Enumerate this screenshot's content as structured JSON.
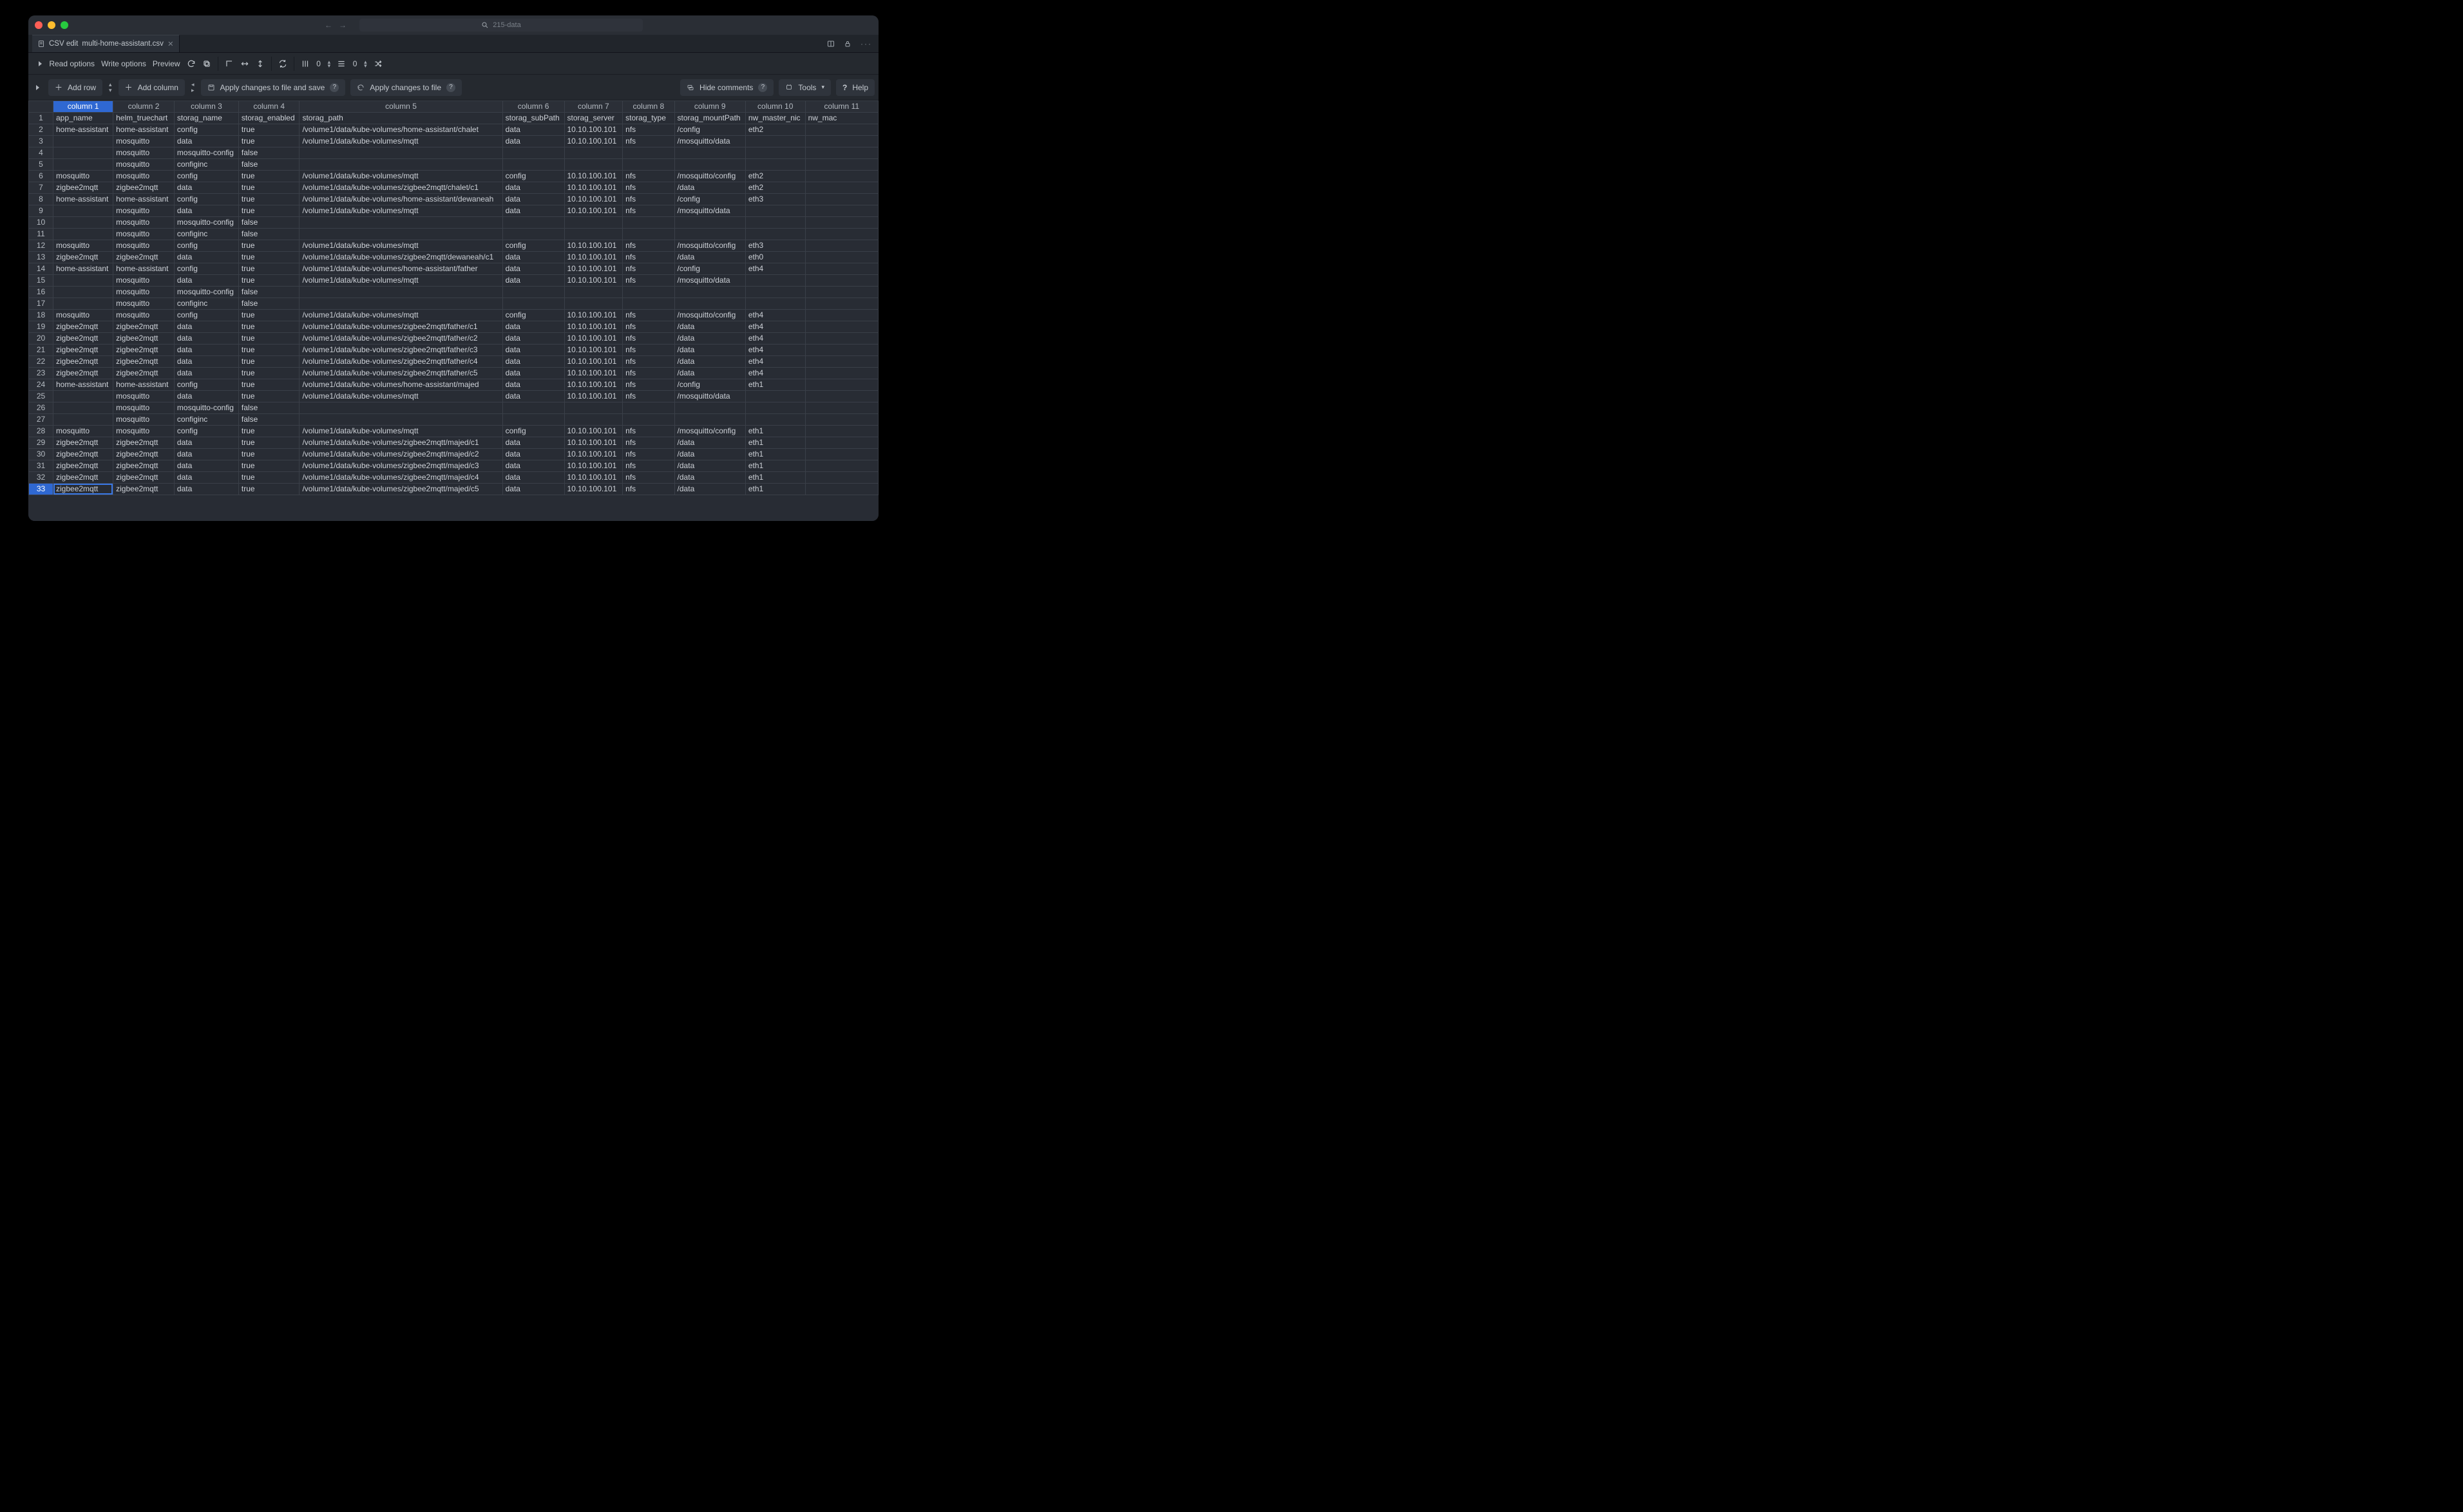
{
  "titlebar": {
    "search_text": "215-data"
  },
  "tab": {
    "prefix": "CSV edit",
    "filename": "multi-home-assistant.csv"
  },
  "toolbar": {
    "read_options": "Read options",
    "write_options": "Write options",
    "preview": "Preview",
    "colwidth_val": "0",
    "rowheight_val": "0"
  },
  "actionbar": {
    "add_row": "Add row",
    "add_column": "Add column",
    "apply_save": "Apply changes to file and save",
    "apply": "Apply changes to file",
    "hide_comments": "Hide comments",
    "tools": "Tools",
    "help": "Help"
  },
  "columns": [
    "",
    "column 1",
    "column 2",
    "column 3",
    "column 4",
    "column 5",
    "column 6",
    "column 7",
    "column 8",
    "column 9",
    "column 10",
    "column 11"
  ],
  "selected_col": 1,
  "selected_row": 33,
  "rows": [
    [
      "app_name",
      "helm_truechart",
      "storag_name",
      "storag_enabled",
      "storag_path",
      "storag_subPath",
      "storag_server",
      "storag_type",
      "storag_mountPath",
      "nw_master_nic",
      "nw_mac"
    ],
    [
      "home-assistant",
      "home-assistant",
      "config",
      "true",
      "/volume1/data/kube-volumes/home-assistant/chalet",
      "data",
      "10.10.100.101",
      "nfs",
      "/config",
      "eth2",
      ""
    ],
    [
      "",
      "mosquitto",
      "data",
      "true",
      "/volume1/data/kube-volumes/mqtt",
      "data",
      "10.10.100.101",
      "nfs",
      "/mosquitto/data",
      "",
      ""
    ],
    [
      "",
      "mosquitto",
      "mosquitto-config",
      "false",
      "",
      "",
      "",
      "",
      "",
      "",
      ""
    ],
    [
      "",
      "mosquitto",
      "configinc",
      "false",
      "",
      "",
      "",
      "",
      "",
      "",
      ""
    ],
    [
      "mosquitto",
      "mosquitto",
      "config",
      "true",
      "/volume1/data/kube-volumes/mqtt",
      "config",
      "10.10.100.101",
      "nfs",
      "/mosquitto/config",
      "eth2",
      ""
    ],
    [
      "zigbee2mqtt",
      "zigbee2mqtt",
      "data",
      "true",
      "/volume1/data/kube-volumes/zigbee2mqtt/chalet/c1",
      "data",
      "10.10.100.101",
      "nfs",
      "/data",
      "eth2",
      ""
    ],
    [
      "home-assistant",
      "home-assistant",
      "config",
      "true",
      "/volume1/data/kube-volumes/home-assistant/dewaneah",
      "data",
      "10.10.100.101",
      "nfs",
      "/config",
      "eth3",
      ""
    ],
    [
      "",
      "mosquitto",
      "data",
      "true",
      "/volume1/data/kube-volumes/mqtt",
      "data",
      "10.10.100.101",
      "nfs",
      "/mosquitto/data",
      "",
      ""
    ],
    [
      "",
      "mosquitto",
      "mosquitto-config",
      "false",
      "",
      "",
      "",
      "",
      "",
      "",
      ""
    ],
    [
      "",
      "mosquitto",
      "configinc",
      "false",
      "",
      "",
      "",
      "",
      "",
      "",
      ""
    ],
    [
      "mosquitto",
      "mosquitto",
      "config",
      "true",
      "/volume1/data/kube-volumes/mqtt",
      "config",
      "10.10.100.101",
      "nfs",
      "/mosquitto/config",
      "eth3",
      ""
    ],
    [
      "zigbee2mqtt",
      "zigbee2mqtt",
      "data",
      "true",
      "/volume1/data/kube-volumes/zigbee2mqtt/dewaneah/c1",
      "data",
      "10.10.100.101",
      "nfs",
      "/data",
      "eth0",
      ""
    ],
    [
      "home-assistant",
      "home-assistant",
      "config",
      "true",
      "/volume1/data/kube-volumes/home-assistant/father",
      "data",
      "10.10.100.101",
      "nfs",
      "/config",
      "eth4",
      ""
    ],
    [
      "",
      "mosquitto",
      "data",
      "true",
      "/volume1/data/kube-volumes/mqtt",
      "data",
      "10.10.100.101",
      "nfs",
      "/mosquitto/data",
      "",
      ""
    ],
    [
      "",
      "mosquitto",
      "mosquitto-config",
      "false",
      "",
      "",
      "",
      "",
      "",
      "",
      ""
    ],
    [
      "",
      "mosquitto",
      "configinc",
      "false",
      "",
      "",
      "",
      "",
      "",
      "",
      ""
    ],
    [
      "mosquitto",
      "mosquitto",
      "config",
      "true",
      "/volume1/data/kube-volumes/mqtt",
      "config",
      "10.10.100.101",
      "nfs",
      "/mosquitto/config",
      "eth4",
      ""
    ],
    [
      "zigbee2mqtt",
      "zigbee2mqtt",
      "data",
      "true",
      "/volume1/data/kube-volumes/zigbee2mqtt/father/c1",
      "data",
      "10.10.100.101",
      "nfs",
      "/data",
      "eth4",
      ""
    ],
    [
      "zigbee2mqtt",
      "zigbee2mqtt",
      "data",
      "true",
      "/volume1/data/kube-volumes/zigbee2mqtt/father/c2",
      "data",
      "10.10.100.101",
      "nfs",
      "/data",
      "eth4",
      ""
    ],
    [
      "zigbee2mqtt",
      "zigbee2mqtt",
      "data",
      "true",
      "/volume1/data/kube-volumes/zigbee2mqtt/father/c3",
      "data",
      "10.10.100.101",
      "nfs",
      "/data",
      "eth4",
      ""
    ],
    [
      "zigbee2mqtt",
      "zigbee2mqtt",
      "data",
      "true",
      "/volume1/data/kube-volumes/zigbee2mqtt/father/c4",
      "data",
      "10.10.100.101",
      "nfs",
      "/data",
      "eth4",
      ""
    ],
    [
      "zigbee2mqtt",
      "zigbee2mqtt",
      "data",
      "true",
      "/volume1/data/kube-volumes/zigbee2mqtt/father/c5",
      "data",
      "10.10.100.101",
      "nfs",
      "/data",
      "eth4",
      ""
    ],
    [
      "home-assistant",
      "home-assistant",
      "config",
      "true",
      "/volume1/data/kube-volumes/home-assistant/majed",
      "data",
      "10.10.100.101",
      "nfs",
      "/config",
      "eth1",
      ""
    ],
    [
      "",
      "mosquitto",
      "data",
      "true",
      "/volume1/data/kube-volumes/mqtt",
      "data",
      "10.10.100.101",
      "nfs",
      "/mosquitto/data",
      "",
      ""
    ],
    [
      "",
      "mosquitto",
      "mosquitto-config",
      "false",
      "",
      "",
      "",
      "",
      "",
      "",
      ""
    ],
    [
      "",
      "mosquitto",
      "configinc",
      "false",
      "",
      "",
      "",
      "",
      "",
      "",
      ""
    ],
    [
      "mosquitto",
      "mosquitto",
      "config",
      "true",
      "/volume1/data/kube-volumes/mqtt",
      "config",
      "10.10.100.101",
      "nfs",
      "/mosquitto/config",
      "eth1",
      ""
    ],
    [
      "zigbee2mqtt",
      "zigbee2mqtt",
      "data",
      "true",
      "/volume1/data/kube-volumes/zigbee2mqtt/majed/c1",
      "data",
      "10.10.100.101",
      "nfs",
      "/data",
      "eth1",
      ""
    ],
    [
      "zigbee2mqtt",
      "zigbee2mqtt",
      "data",
      "true",
      "/volume1/data/kube-volumes/zigbee2mqtt/majed/c2",
      "data",
      "10.10.100.101",
      "nfs",
      "/data",
      "eth1",
      ""
    ],
    [
      "zigbee2mqtt",
      "zigbee2mqtt",
      "data",
      "true",
      "/volume1/data/kube-volumes/zigbee2mqtt/majed/c3",
      "data",
      "10.10.100.101",
      "nfs",
      "/data",
      "eth1",
      ""
    ],
    [
      "zigbee2mqtt",
      "zigbee2mqtt",
      "data",
      "true",
      "/volume1/data/kube-volumes/zigbee2mqtt/majed/c4",
      "data",
      "10.10.100.101",
      "nfs",
      "/data",
      "eth1",
      ""
    ],
    [
      "zigbee2mqtt",
      "zigbee2mqtt",
      "data",
      "true",
      "/volume1/data/kube-volumes/zigbee2mqtt/majed/c5",
      "data",
      "10.10.100.101",
      "nfs",
      "/data",
      "eth1",
      ""
    ]
  ]
}
